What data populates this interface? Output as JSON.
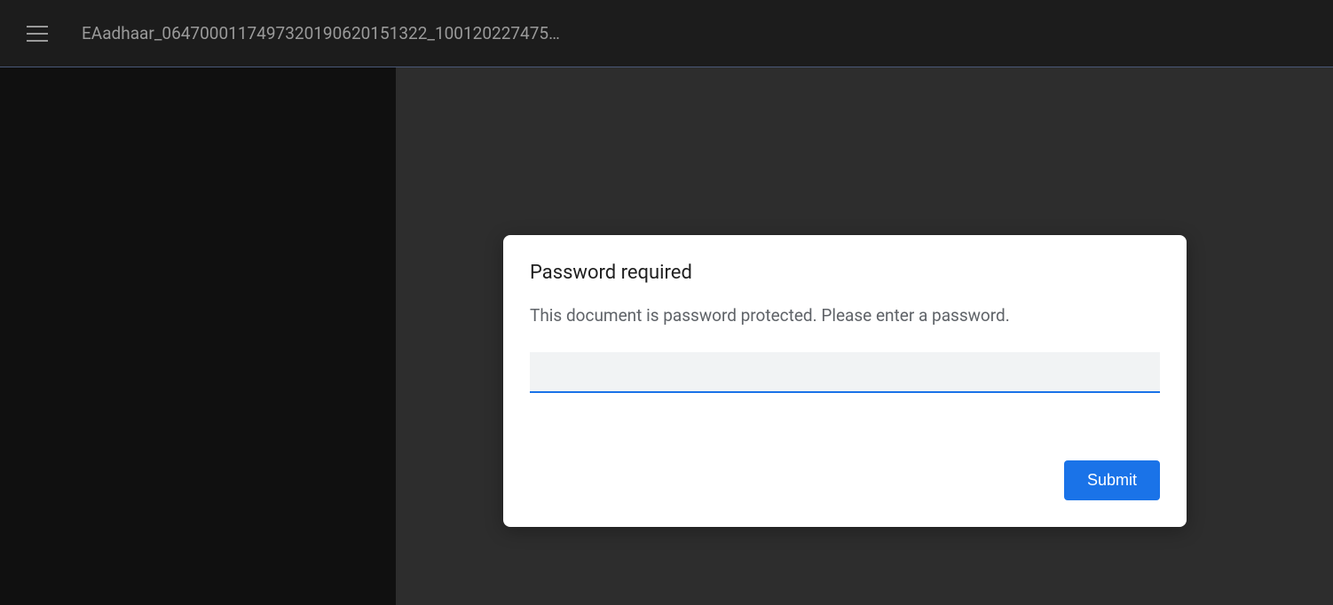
{
  "header": {
    "document_title": "EAadhaar_064700011749732019062015132​2_100120227475…"
  },
  "dialog": {
    "title": "Password required",
    "message": "This document is password protected. Please enter a password.",
    "input_value": "",
    "submit_label": "Submit"
  }
}
